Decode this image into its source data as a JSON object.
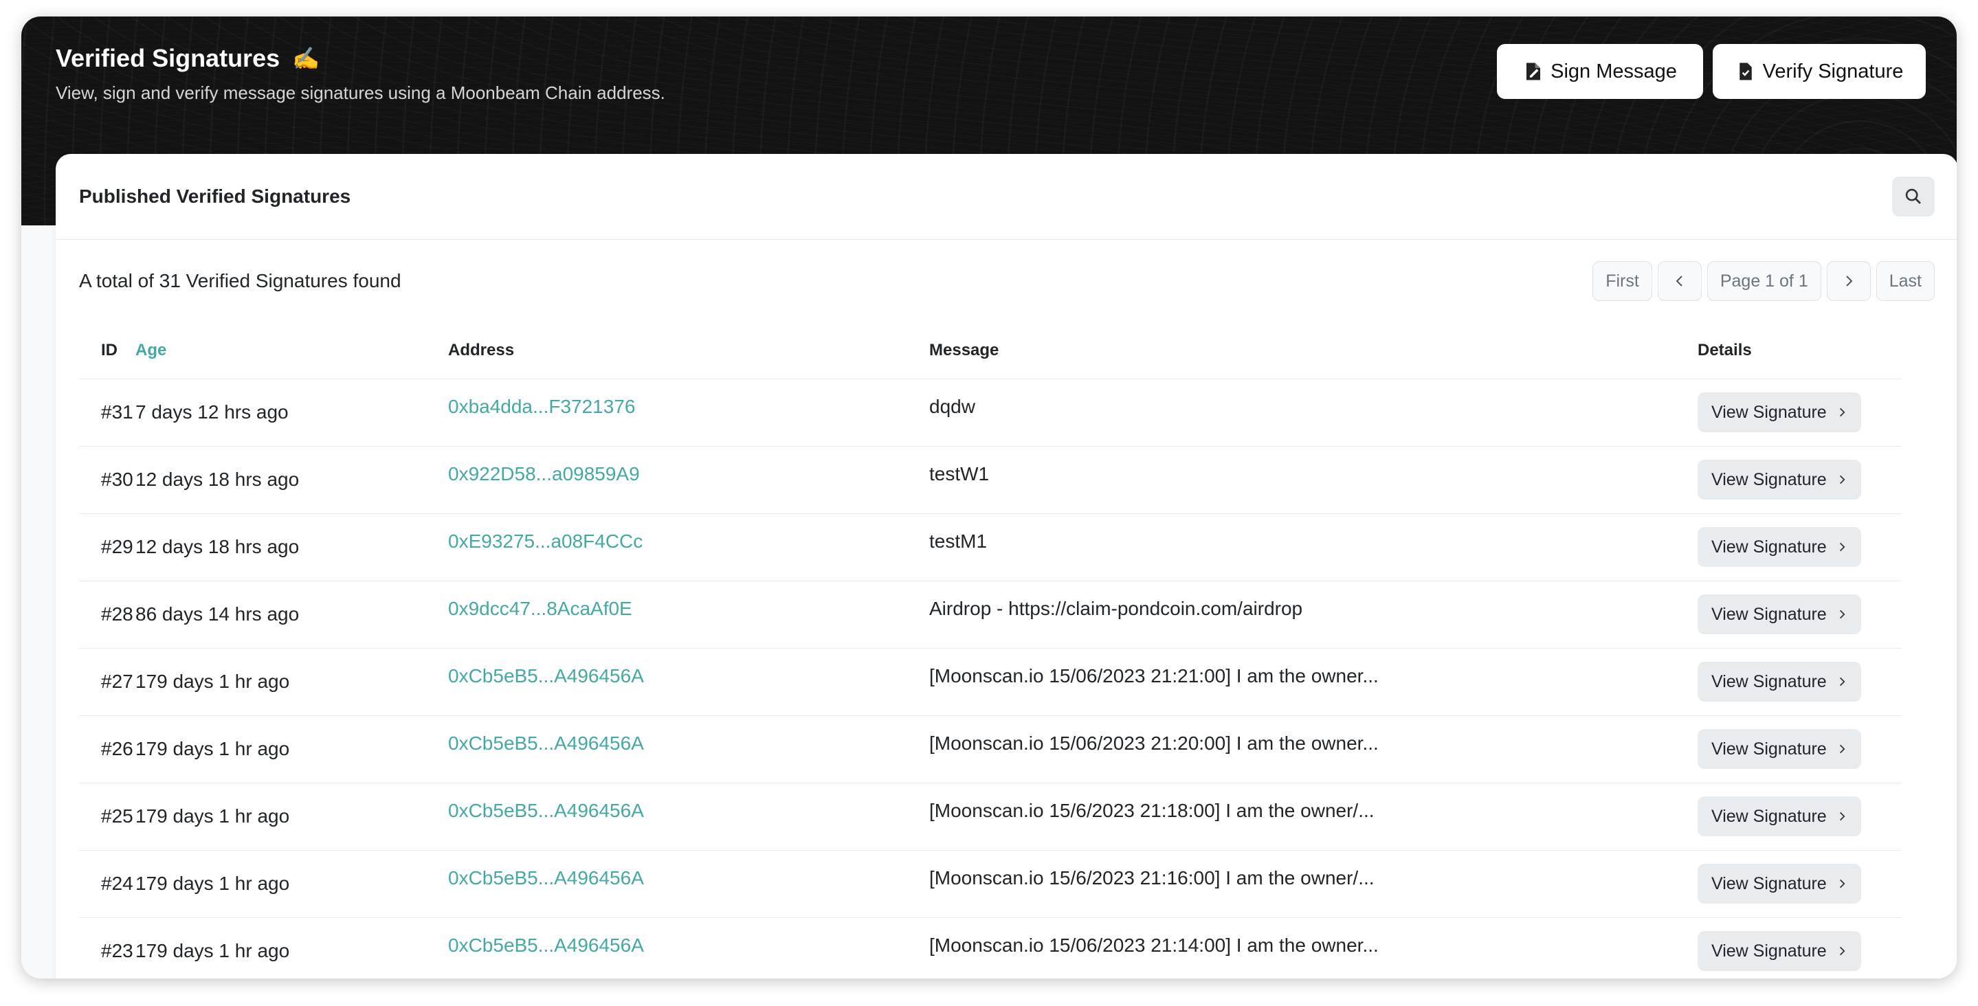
{
  "header": {
    "title": "Verified Signatures",
    "emoji": "✍️",
    "subtitle": "View, sign and verify message signatures using a Moonbeam Chain address.",
    "sign_label": "Sign Message",
    "verify_label": "Verify Signature"
  },
  "card": {
    "title": "Published Verified Signatures",
    "total_text": "A total of 31 Verified Signatures found"
  },
  "pagination": {
    "first": "First",
    "page_text": "Page 1 of 1",
    "last": "Last"
  },
  "table": {
    "columns": {
      "id": "ID",
      "age": "Age",
      "address": "Address",
      "message": "Message",
      "details": "Details"
    },
    "view_label": "View Signature",
    "rows": [
      {
        "id": "#31",
        "age": "7 days 12 hrs ago",
        "address": "0xba4dda...F3721376",
        "message": "dqdw"
      },
      {
        "id": "#30",
        "age": "12 days 18 hrs ago",
        "address": "0x922D58...a09859A9",
        "message": "testW1"
      },
      {
        "id": "#29",
        "age": "12 days 18 hrs ago",
        "address": "0xE93275...a08F4CCc",
        "message": "testM1"
      },
      {
        "id": "#28",
        "age": "86 days 14 hrs ago",
        "address": "0x9dcc47...8AcaAf0E",
        "message": "Airdrop - https://claim-pondcoin.com/airdrop"
      },
      {
        "id": "#27",
        "age": "179 days 1 hr ago",
        "address": "0xCb5eB5...A496456A",
        "message": "[Moonscan.io 15/06/2023 21:21:00] I am the owner..."
      },
      {
        "id": "#26",
        "age": "179 days 1 hr ago",
        "address": "0xCb5eB5...A496456A",
        "message": "[Moonscan.io 15/06/2023 21:20:00] I am the owner..."
      },
      {
        "id": "#25",
        "age": "179 days 1 hr ago",
        "address": "0xCb5eB5...A496456A",
        "message": "[Moonscan.io 15/6/2023 21:18:00] I am the owner/..."
      },
      {
        "id": "#24",
        "age": "179 days 1 hr ago",
        "address": "0xCb5eB5...A496456A",
        "message": "[Moonscan.io 15/6/2023 21:16:00] I am the owner/..."
      },
      {
        "id": "#23",
        "age": "179 days 1 hr ago",
        "address": "0xCb5eB5...A496456A",
        "message": "[Moonscan.io 15/06/2023 21:14:00] I am the owner..."
      }
    ]
  }
}
